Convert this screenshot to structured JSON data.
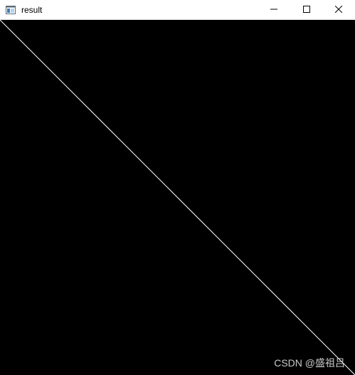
{
  "window": {
    "title": "result",
    "controls": {
      "minimize_icon": "minimize-icon",
      "maximize_icon": "maximize-icon",
      "close_icon": "close-icon"
    }
  },
  "image": {
    "background_color": "#000000",
    "line_color": "#ffffff"
  },
  "watermark": {
    "text": "CSDN @盛祖吕"
  }
}
